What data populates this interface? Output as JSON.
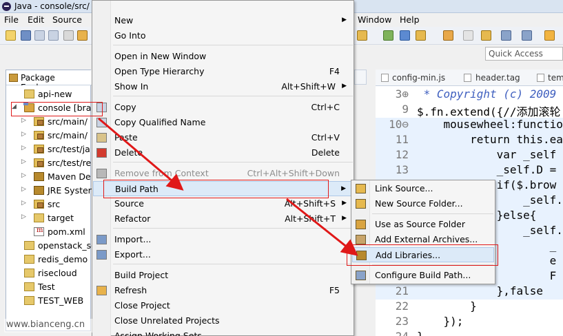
{
  "window": {
    "title": "Java - console/src/"
  },
  "menubar": {
    "file": "File",
    "edit": "Edit",
    "source": "Source",
    "window": "Window",
    "help": "Help"
  },
  "quick_access": {
    "placeholder": "Quick Access"
  },
  "package_explorer": {
    "tab_label": "Package Explorer",
    "items": [
      {
        "label": "api-new",
        "icon": "project-icon",
        "arrow": ""
      },
      {
        "label": "console [bra",
        "icon": "maven-project-icon",
        "arrow": "◢"
      },
      {
        "label": "src/main/",
        "icon": "source-folder-icon",
        "arrow": "▷"
      },
      {
        "label": "src/main/",
        "icon": "source-folder-icon",
        "arrow": "▷"
      },
      {
        "label": "src/test/ja",
        "icon": "source-folder-icon",
        "arrow": "▷"
      },
      {
        "label": "src/test/re",
        "icon": "source-folder-icon",
        "arrow": "▷"
      },
      {
        "label": "Maven De",
        "icon": "library-icon",
        "arrow": "▷"
      },
      {
        "label": "JRE Syster",
        "icon": "library-icon",
        "arrow": "▷"
      },
      {
        "label": "src",
        "icon": "source-folder-icon",
        "arrow": "▷"
      },
      {
        "label": "target",
        "icon": "folder-icon",
        "arrow": "▷"
      },
      {
        "label": "pom.xml",
        "icon": "xml-file-icon",
        "arrow": ""
      },
      {
        "label": "openstack_so",
        "icon": "project-icon",
        "arrow": ""
      },
      {
        "label": "redis_demo",
        "icon": "project-icon",
        "arrow": ""
      },
      {
        "label": "risecloud",
        "icon": "project-icon",
        "arrow": ""
      },
      {
        "label": "Test",
        "icon": "project-icon",
        "arrow": ""
      },
      {
        "label": "TEST_WEB",
        "icon": "project-icon",
        "arrow": ""
      }
    ]
  },
  "editor_tabs": [
    {
      "label": "config-min.js"
    },
    {
      "label": "header.tag"
    },
    {
      "label": "tem"
    }
  ],
  "editor": {
    "lines": [
      {
        "num": "3⊕",
        "code": " * Copyright (c) 2009",
        "style": "doc"
      },
      {
        "num": "9",
        "code": "$.fn.extend({//添加滚轮",
        "style": "plain"
      },
      {
        "num": "10⊖",
        "code": "    mousewheel:functio",
        "style": "plain"
      },
      {
        "num": "11",
        "code": "        return this.ea",
        "style": "plain"
      },
      {
        "num": "12",
        "code": "            var _self",
        "style": "plain"
      },
      {
        "num": "13",
        "code": "            _self.D =",
        "style": "plain"
      },
      {
        "num": "14⊖",
        "code": "            if($.brow",
        "style": "plain"
      },
      {
        "num": "15",
        "code": "                _self.c",
        "style": "plain"
      },
      {
        "num": "16",
        "code": "            }else{",
        "style": "plain"
      },
      {
        "num": "17",
        "code": "                _self.a",
        "style": "plain"
      },
      {
        "num": "18",
        "code": "                    _",
        "style": "plain"
      },
      {
        "num": "19",
        "code": "                    e",
        "style": "plain"
      },
      {
        "num": "20",
        "code": "                    F",
        "style": "plain"
      },
      {
        "num": "21",
        "code": "            },false",
        "style": "plain"
      },
      {
        "num": "22",
        "code": "        }",
        "style": "plain"
      },
      {
        "num": "23",
        "code": "    });",
        "style": "plain"
      },
      {
        "num": "24",
        "code": "}",
        "style": "plain"
      }
    ]
  },
  "context_menu": {
    "items": [
      {
        "label": "New",
        "shortcut": "",
        "submenu": true
      },
      {
        "label": "Go Into",
        "shortcut": "",
        "submenu": false
      },
      {
        "label": "Open in New Window",
        "shortcut": "",
        "submenu": false
      },
      {
        "label": "Open Type Hierarchy",
        "shortcut": "F4",
        "submenu": false
      },
      {
        "label": "Show In",
        "shortcut": "Alt+Shift+W",
        "submenu": true
      },
      {
        "label": "Copy",
        "shortcut": "Ctrl+C",
        "submenu": false
      },
      {
        "label": "Copy Qualified Name",
        "shortcut": "",
        "submenu": false
      },
      {
        "label": "Paste",
        "shortcut": "Ctrl+V",
        "submenu": false
      },
      {
        "label": "Delete",
        "shortcut": "Delete",
        "submenu": false
      },
      {
        "label": "Remove from Context",
        "shortcut": "Ctrl+Alt+Shift+Down",
        "submenu": false
      },
      {
        "label": "Build Path",
        "shortcut": "",
        "submenu": true
      },
      {
        "label": "Source",
        "shortcut": "Alt+Shift+S",
        "submenu": true
      },
      {
        "label": "Refactor",
        "shortcut": "Alt+Shift+T",
        "submenu": true
      },
      {
        "label": "Import...",
        "shortcut": "",
        "submenu": false
      },
      {
        "label": "Export...",
        "shortcut": "",
        "submenu": false
      },
      {
        "label": "Build Project",
        "shortcut": "",
        "submenu": false
      },
      {
        "label": "Refresh",
        "shortcut": "F5",
        "submenu": false
      },
      {
        "label": "Close Project",
        "shortcut": "",
        "submenu": false
      },
      {
        "label": "Close Unrelated Projects",
        "shortcut": "",
        "submenu": false
      },
      {
        "label": "Assign Working Sets...",
        "shortcut": "",
        "submenu": false
      }
    ]
  },
  "build_path_submenu": {
    "items": [
      {
        "label": "Link Source..."
      },
      {
        "label": "New Source Folder..."
      },
      {
        "label": "Use as Source Folder"
      },
      {
        "label": "Add External Archives..."
      },
      {
        "label": "Add Libraries..."
      },
      {
        "label": "Configure Build Path..."
      }
    ]
  },
  "watermark": {
    "text": "www.bianceng.cn"
  },
  "colors": {
    "annotation_red": "#e01818",
    "menu_highlight": "#dceaf8",
    "editor_keyword": "#7f0055"
  }
}
